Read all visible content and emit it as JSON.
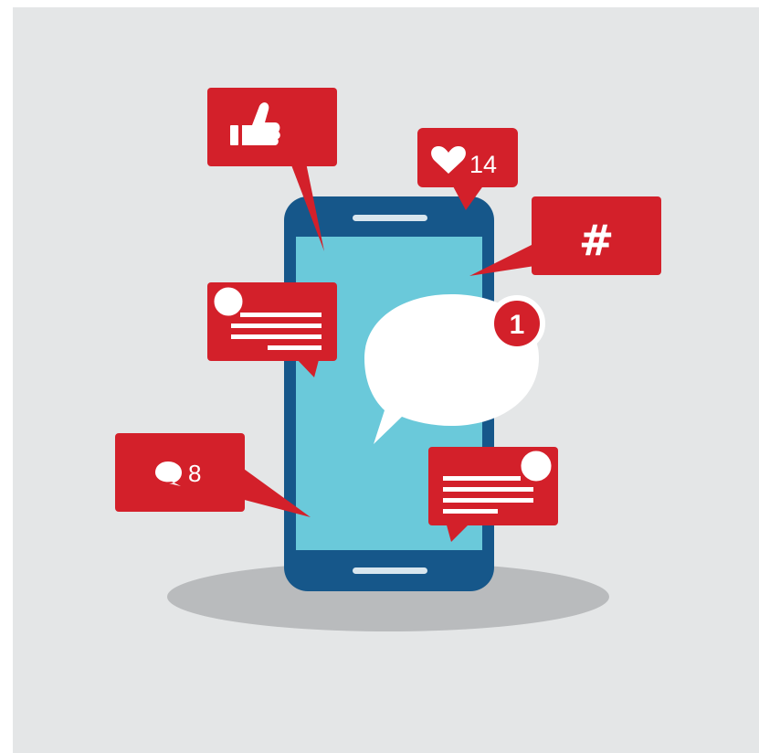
{
  "illustration": {
    "theme": "smartphone-social-media-notifications",
    "colors": {
      "background": "#e4e6e7",
      "phone_body": "#16578a",
      "phone_screen": "#6ac9da",
      "notification_red": "#d3202a",
      "shadow": "#b9bbbd",
      "white": "#ffffff"
    },
    "notifications": {
      "like": {
        "icon": "thumbs-up-icon"
      },
      "hearts": {
        "icon": "heart-icon",
        "count": "14"
      },
      "hashtag": {
        "icon": "hashtag-icon",
        "symbol": "#"
      },
      "comments": {
        "icon": "comment-icon",
        "count": "8"
      },
      "post_left": {
        "icon": "avatar-icon"
      },
      "post_right": {
        "icon": "avatar-icon"
      }
    },
    "message": {
      "icon": "speech-bubble-icon",
      "unread_badge": "1"
    }
  }
}
